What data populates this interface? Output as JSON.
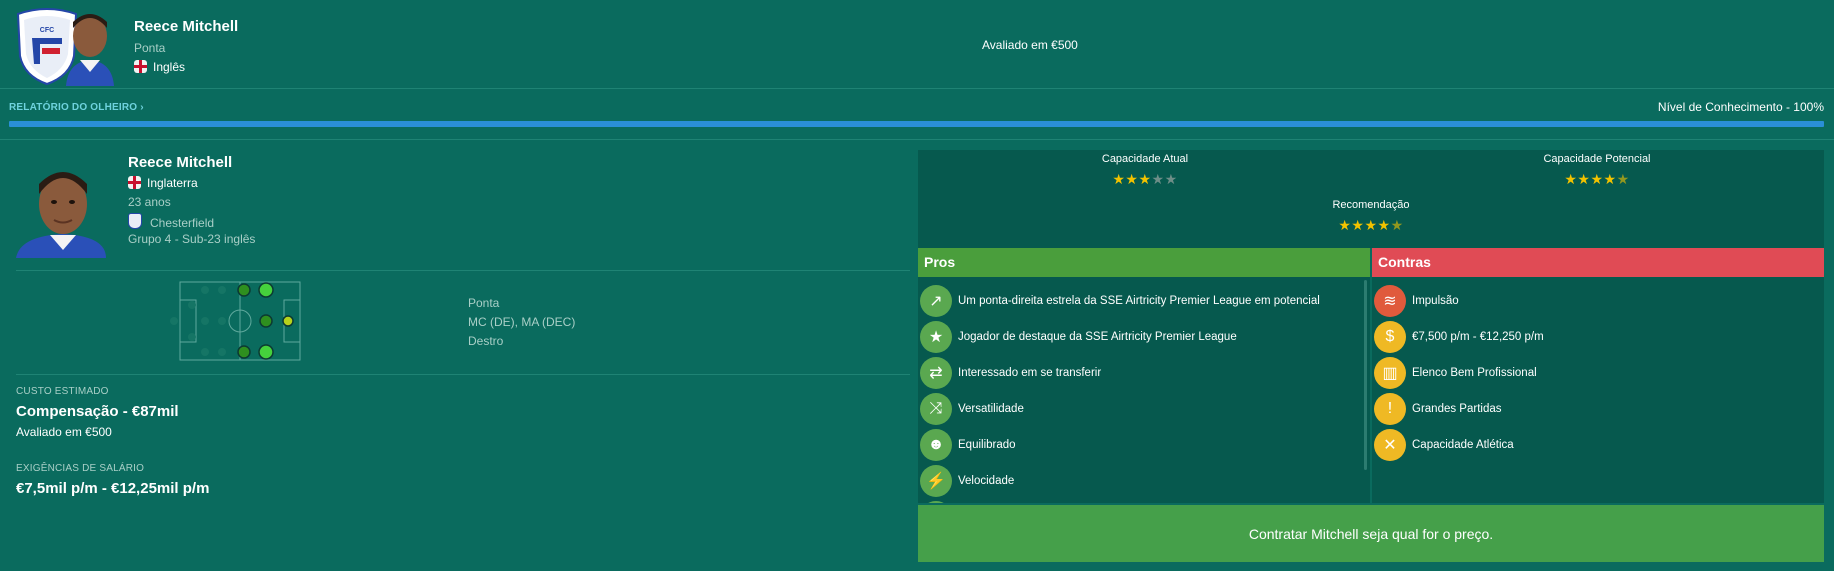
{
  "header": {
    "name": "Reece Mitchell",
    "position": "Ponta",
    "nationality": "Inglês",
    "valued": "Avaliado em €500"
  },
  "scout": {
    "link_label": "RELATÓRIO DO OLHEIRO",
    "knowledge": "Nível de Conhecimento - 100%",
    "knowledge_level": 1.0
  },
  "player": {
    "name": "Reece Mitchell",
    "country": "Inglaterra",
    "age": "23 anos",
    "club": "Chesterfield",
    "squad": "Grupo 4 - Sub-23 inglês"
  },
  "positions": {
    "role": "Ponta",
    "list": "MC (DE), MA (DEC)",
    "foot": "Destro"
  },
  "cost": {
    "label": "CUSTO ESTIMADO",
    "value": "Compensação - €87mil",
    "valued": "Avaliado em €500"
  },
  "wages": {
    "label": "EXIGÊNCIAS DE SALÁRIO",
    "value": "€7,5mil p/m - €12,25mil p/m"
  },
  "ratings": {
    "current_label": "Capacidade Atual",
    "current_stars": 3,
    "potential_label": "Capacidade Potencial",
    "potential_stars": 4.5,
    "recommendation_label": "Recomendação",
    "recommendation_stars": 4.5
  },
  "pros": {
    "title": "Pros",
    "items": [
      {
        "text": "Um ponta-direita estrela da SSE Airtricity Premier League em potencial",
        "icon": "trend-up-icon"
      },
      {
        "text": "Jogador de destaque da SSE Airtricity Premier League",
        "icon": "star-icon"
      },
      {
        "text": "Interessado em se transferir",
        "icon": "transfer-icon"
      },
      {
        "text": "Versatilidade",
        "icon": "versatility-icon"
      },
      {
        "text": "Equilibrado",
        "icon": "head-icon"
      },
      {
        "text": "Velocidade",
        "icon": "speed-icon"
      }
    ]
  },
  "cons": {
    "title": "Contras",
    "items": [
      {
        "text": "Impulsão",
        "icon": "spring-icon",
        "color": "red"
      },
      {
        "text": "€7,500 p/m - €12,250 p/m",
        "icon": "money-bag-icon",
        "color": "yellow"
      },
      {
        "text": "Elenco Bem Profissional",
        "icon": "squad-icon",
        "color": "yellow"
      },
      {
        "text": "Grandes Partidas",
        "icon": "big-match-icon",
        "color": "yellow"
      },
      {
        "text": "Capacidade Atlética",
        "icon": "athletic-icon",
        "color": "yellow"
      }
    ]
  },
  "cta": "Contratar Mitchell seja qual for o preço.",
  "colors": {
    "background": "#0a6b5e",
    "pros": "#4a9e3c",
    "cons": "#e04b55",
    "progress": "#2a8fd6",
    "cta": "#45a04a"
  }
}
